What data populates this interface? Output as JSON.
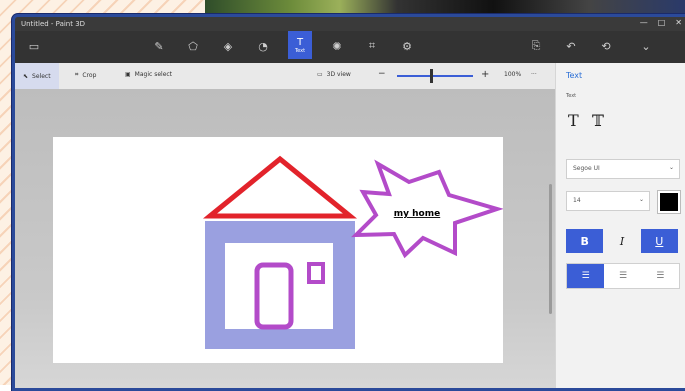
{
  "app": {
    "title": "Untitled - Paint 3D"
  },
  "toolbar": {
    "tools": [
      {
        "name": "brushes",
        "icon": "✎"
      },
      {
        "name": "2d-shapes",
        "icon": "⬠"
      },
      {
        "name": "3d-shapes",
        "icon": "◈"
      },
      {
        "name": "stickers",
        "icon": "◔"
      },
      {
        "name": "text",
        "icon": "T",
        "label": "Text"
      },
      {
        "name": "effects",
        "icon": "✺"
      },
      {
        "name": "canvas",
        "icon": "⌗"
      },
      {
        "name": "3d-library",
        "icon": "⚙"
      }
    ],
    "right": [
      {
        "icon": "⎘"
      },
      {
        "icon": "↶"
      },
      {
        "icon": "⟲"
      },
      {
        "icon": "⌄"
      }
    ]
  },
  "subbar": {
    "select": "Select",
    "crop": "Crop",
    "magic_select": "Magic select",
    "view": "3D view",
    "zoom_minus": "−",
    "zoom_plus": "+",
    "zoom": "100%",
    "more": "···",
    "zoom_level": 0.43
  },
  "panel": {
    "title": "Text",
    "sub": "Text",
    "font": "Segoe UI",
    "size": "14",
    "bold": "B",
    "italic": "I",
    "underline": "U",
    "text_color": "#000000"
  },
  "canvas": {
    "caption": "my home",
    "colors": {
      "roof": "#e2232b",
      "wall": "#9aa0e0",
      "door": "#b34bc9",
      "star": "#b34bc9"
    }
  }
}
